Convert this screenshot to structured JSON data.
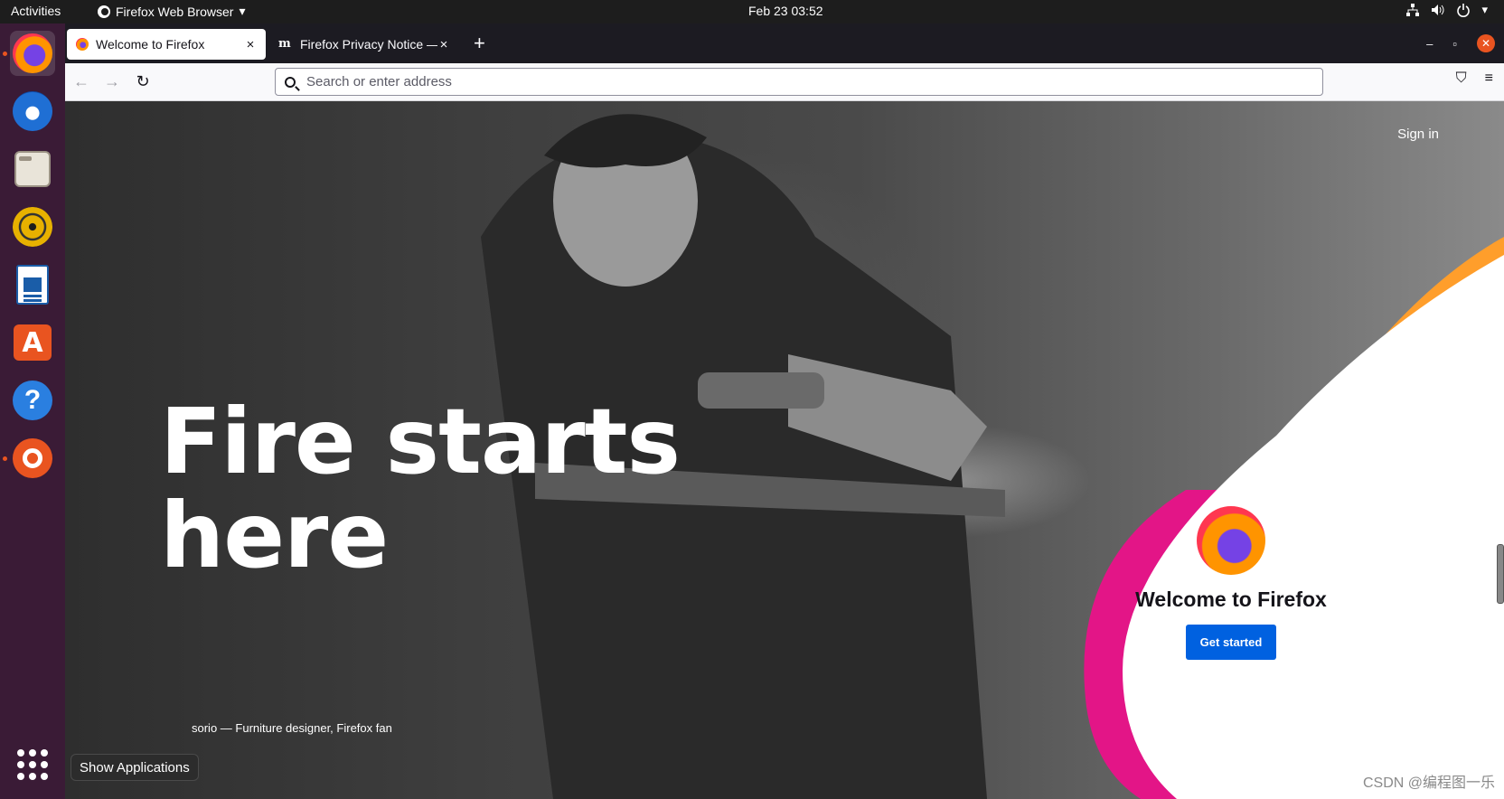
{
  "topbar": {
    "activities": "Activities",
    "app_menu": "Firefox Web Browser",
    "app_menu_arrow": "▾",
    "clock": "Feb 23  03:52",
    "tray": {
      "network": "network-icon",
      "volume": "volume-icon",
      "power": "power-icon",
      "power_arrow": "▾"
    }
  },
  "dock": {
    "items": [
      {
        "name": "Firefox Web Browser",
        "icon": "firefox-icon",
        "active": true
      },
      {
        "name": "Thunderbird Mail",
        "icon": "thunderbird-icon"
      },
      {
        "name": "Files",
        "icon": "files-icon"
      },
      {
        "name": "Rhythmbox",
        "icon": "rhythmbox-icon"
      },
      {
        "name": "LibreOffice Writer",
        "icon": "writer-icon"
      },
      {
        "name": "Ubuntu Software",
        "icon": "software-store-icon",
        "glyph": "A"
      },
      {
        "name": "Help",
        "icon": "help-icon",
        "glyph": "?"
      },
      {
        "name": "Ubuntu",
        "icon": "ubuntu-icon",
        "running": true
      }
    ],
    "show_apps_tooltip": "Show Applications"
  },
  "browser": {
    "tabs": [
      {
        "title": "Welcome to Firefox",
        "close": "×",
        "selected": true
      },
      {
        "title": "Firefox Privacy Notice —",
        "icon_glyph": "m",
        "close": "×"
      }
    ],
    "new_tab": "+",
    "window_controls": {
      "minimize": "–",
      "maximize": "▫",
      "close": "✕"
    },
    "nav": {
      "back": "←",
      "forward": "→",
      "reload": "↻",
      "pocket": "⛉",
      "menu": "≡"
    },
    "urlbar": {
      "placeholder": "Search or enter address"
    }
  },
  "page": {
    "sign_in": "Sign in",
    "headline": "Fire starts here",
    "photo_credit": "sorio — Furniture designer, Firefox fan",
    "welcome_title": "Welcome to Firefox",
    "get_started": "Get started"
  },
  "watermark": "CSDN @编程图一乐",
  "colors": {
    "accent": "#0061e0",
    "ubuntu_orange": "#e95420",
    "dock_bg": "#3a1b36",
    "swoosh_pink": "#e31587",
    "swoosh_orange": "#ff9e2b"
  }
}
